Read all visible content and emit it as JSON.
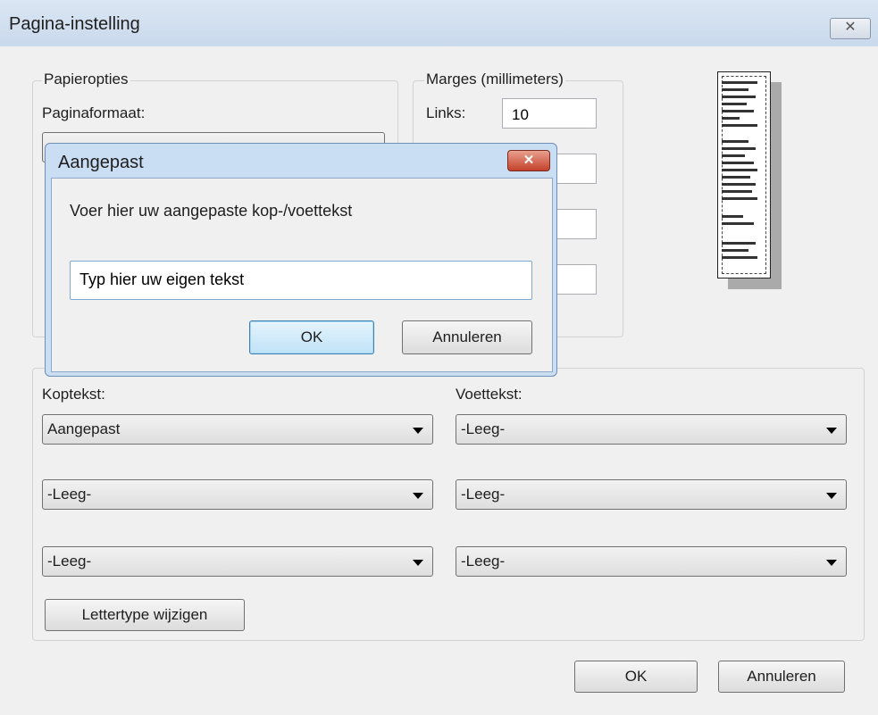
{
  "window": {
    "title": "Pagina-instelling",
    "close_glyph": "✕"
  },
  "paper": {
    "group_label": "Papieropties",
    "format_label": "Paginaformaat:"
  },
  "margins": {
    "group_label": "Marges (millimeters)",
    "left_label": "Links:",
    "left_value": "10"
  },
  "header": {
    "label": "Koptekst:",
    "dropdowns": [
      "Aangepast",
      "-Leeg-",
      "-Leeg-"
    ]
  },
  "footer": {
    "label": "Voettekst:",
    "dropdowns": [
      "-Leeg-",
      "-Leeg-",
      "-Leeg-"
    ]
  },
  "font_button": "Lettertype wijzigen",
  "buttons": {
    "ok": "OK",
    "cancel": "Annuleren"
  },
  "dialog": {
    "title": "Aangepast",
    "close_glyph": "✕",
    "message": "Voer hier uw aangepaste kop-/voettekst",
    "input_value": "Typ hier uw eigen tekst",
    "ok": "OK",
    "cancel": "Annuleren"
  },
  "colors": {
    "dialog_frame": "#c9ddf3",
    "close_red": "#c4412b",
    "focus_blue": "#3c7fb1"
  },
  "icons": [
    "close-icon",
    "chevron-down-icon"
  ]
}
